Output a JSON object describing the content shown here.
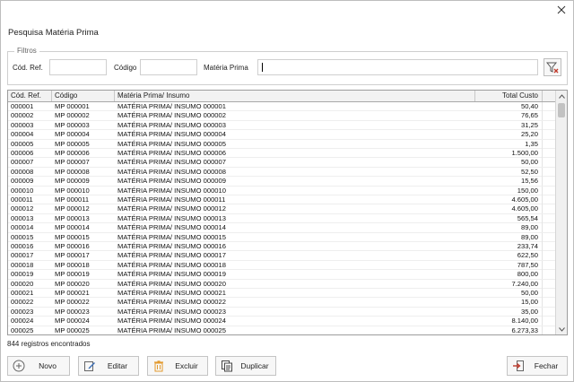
{
  "window": {
    "title": "Pesquisa Matéria Prima"
  },
  "filters": {
    "legend": "Filtros",
    "cod_ref_label": "Cód. Ref.",
    "cod_ref_value": "",
    "codigo_label": "Código",
    "codigo_value": "",
    "materia_label": "Matéria Prima",
    "materia_value": ""
  },
  "grid": {
    "columns": [
      "Cód. Ref.",
      "Código",
      "Matéria Prima/ Insumo",
      "Total Custo"
    ],
    "rows": [
      [
        "000001",
        "MP 000001",
        "MATÉRIA PRIMA/ INSUMO 000001",
        "50,40"
      ],
      [
        "000002",
        "MP 000002",
        "MATÉRIA PRIMA/ INSUMO 000002",
        "76,65"
      ],
      [
        "000003",
        "MP 000003",
        "MATÉRIA PRIMA/ INSUMO 000003",
        "31,25"
      ],
      [
        "000004",
        "MP 000004",
        "MATÉRIA PRIMA/ INSUMO 000004",
        "25,20"
      ],
      [
        "000005",
        "MP 000005",
        "MATÉRIA PRIMA/ INSUMO 000005",
        "1,35"
      ],
      [
        "000006",
        "MP 000006",
        "MATÉRIA PRIMA/ INSUMO 000006",
        "1.500,00"
      ],
      [
        "000007",
        "MP 000007",
        "MATÉRIA PRIMA/ INSUMO 000007",
        "50,00"
      ],
      [
        "000008",
        "MP 000008",
        "MATÉRIA PRIMA/ INSUMO 000008",
        "52,50"
      ],
      [
        "000009",
        "MP 000009",
        "MATÉRIA PRIMA/ INSUMO 000009",
        "15,56"
      ],
      [
        "000010",
        "MP 000010",
        "MATÉRIA PRIMA/ INSUMO 000010",
        "150,00"
      ],
      [
        "000011",
        "MP 000011",
        "MATÉRIA PRIMA/ INSUMO 000011",
        "4.605,00"
      ],
      [
        "000012",
        "MP 000012",
        "MATÉRIA PRIMA/ INSUMO 000012",
        "4.605,00"
      ],
      [
        "000013",
        "MP 000013",
        "MATÉRIA PRIMA/ INSUMO 000013",
        "565,54"
      ],
      [
        "000014",
        "MP 000014",
        "MATÉRIA PRIMA/ INSUMO 000014",
        "89,00"
      ],
      [
        "000015",
        "MP 000015",
        "MATÉRIA PRIMA/ INSUMO 000015",
        "89,00"
      ],
      [
        "000016",
        "MP 000016",
        "MATÉRIA PRIMA/ INSUMO 000016",
        "233,74"
      ],
      [
        "000017",
        "MP 000017",
        "MATÉRIA PRIMA/ INSUMO 000017",
        "622,50"
      ],
      [
        "000018",
        "MP 000018",
        "MATÉRIA PRIMA/ INSUMO 000018",
        "787,50"
      ],
      [
        "000019",
        "MP 000019",
        "MATÉRIA PRIMA/ INSUMO 000019",
        "800,00"
      ],
      [
        "000020",
        "MP 000020",
        "MATÉRIA PRIMA/ INSUMO 000020",
        "7.240,00"
      ],
      [
        "000021",
        "MP 000021",
        "MATÉRIA PRIMA/ INSUMO 000021",
        "50,00"
      ],
      [
        "000022",
        "MP 000022",
        "MATÉRIA PRIMA/ INSUMO 000022",
        "15,00"
      ],
      [
        "000023",
        "MP 000023",
        "MATÉRIA PRIMA/ INSUMO 000023",
        "35,00"
      ],
      [
        "000024",
        "MP 000024",
        "MATÉRIA PRIMA/ INSUMO 000024",
        "8.140,00"
      ],
      [
        "000025",
        "MP 000025",
        "MATÉRIA PRIMA/ INSUMO 000025",
        "6.273,33"
      ]
    ]
  },
  "status": {
    "text": "844 registros encontrados"
  },
  "buttons": {
    "novo": "Novo",
    "editar": "Editar",
    "excluir": "Excluir",
    "duplicar": "Duplicar",
    "fechar": "Fechar"
  },
  "icons": {
    "close": "close-icon",
    "filter": "filter-clear-icon",
    "novo": "plus-circle-icon",
    "editar": "edit-icon",
    "excluir": "trash-icon",
    "duplicar": "copy-icon",
    "fechar": "exit-icon"
  },
  "colors": {
    "accent": "#3b6fb6",
    "filter_icon_red": "#c0392b",
    "trash_orange": "#e39a2d"
  }
}
